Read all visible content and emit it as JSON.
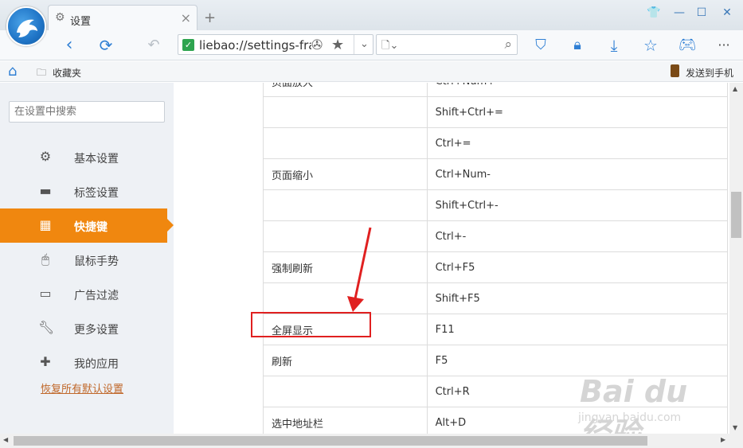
{
  "tab": {
    "title": "设置",
    "icon": "gear-icon"
  },
  "address": {
    "url": "liebao://settings-fra"
  },
  "bookmarks": {
    "favorites": "收藏夹",
    "send_to_phone": "发送到手机"
  },
  "sidebar": {
    "search_placeholder": "在设置中搜索",
    "items": [
      {
        "label": "基本设置",
        "icon": "gear-icon"
      },
      {
        "label": "标签设置",
        "icon": "tab-icon"
      },
      {
        "label": "快捷键",
        "icon": "layout-icon",
        "active": true
      },
      {
        "label": "鼠标手势",
        "icon": "mouse-icon"
      },
      {
        "label": "广告过滤",
        "icon": "window-icon"
      },
      {
        "label": "更多设置",
        "icon": "wrench-icon"
      },
      {
        "label": "我的应用",
        "icon": "puzzle-icon"
      }
    ],
    "restore_defaults": "恢复所有默认设置"
  },
  "shortcuts": {
    "rows": [
      {
        "action": "页面放大",
        "keys": "Ctrl+Num+"
      },
      {
        "action": "",
        "keys": "Shift+Ctrl+="
      },
      {
        "action": "",
        "keys": "Ctrl+="
      },
      {
        "action": "页面缩小",
        "keys": "Ctrl+Num-"
      },
      {
        "action": "",
        "keys": "Shift+Ctrl+-"
      },
      {
        "action": "",
        "keys": "Ctrl+-"
      },
      {
        "action": "强制刷新",
        "keys": "Ctrl+F5"
      },
      {
        "action": "",
        "keys": "Shift+F5"
      },
      {
        "action": "全屏显示",
        "keys": "F11"
      },
      {
        "action": "刷新",
        "keys": "F5"
      },
      {
        "action": "",
        "keys": "Ctrl+R"
      },
      {
        "action": "选中地址栏",
        "keys": "Alt+D"
      }
    ]
  },
  "watermark": {
    "text": "Bai du 经验",
    "sub": "jingyan.baidu.com"
  },
  "colors": {
    "accent": "#f0870f",
    "annotation": "#e02020",
    "link": "#c0682a"
  }
}
